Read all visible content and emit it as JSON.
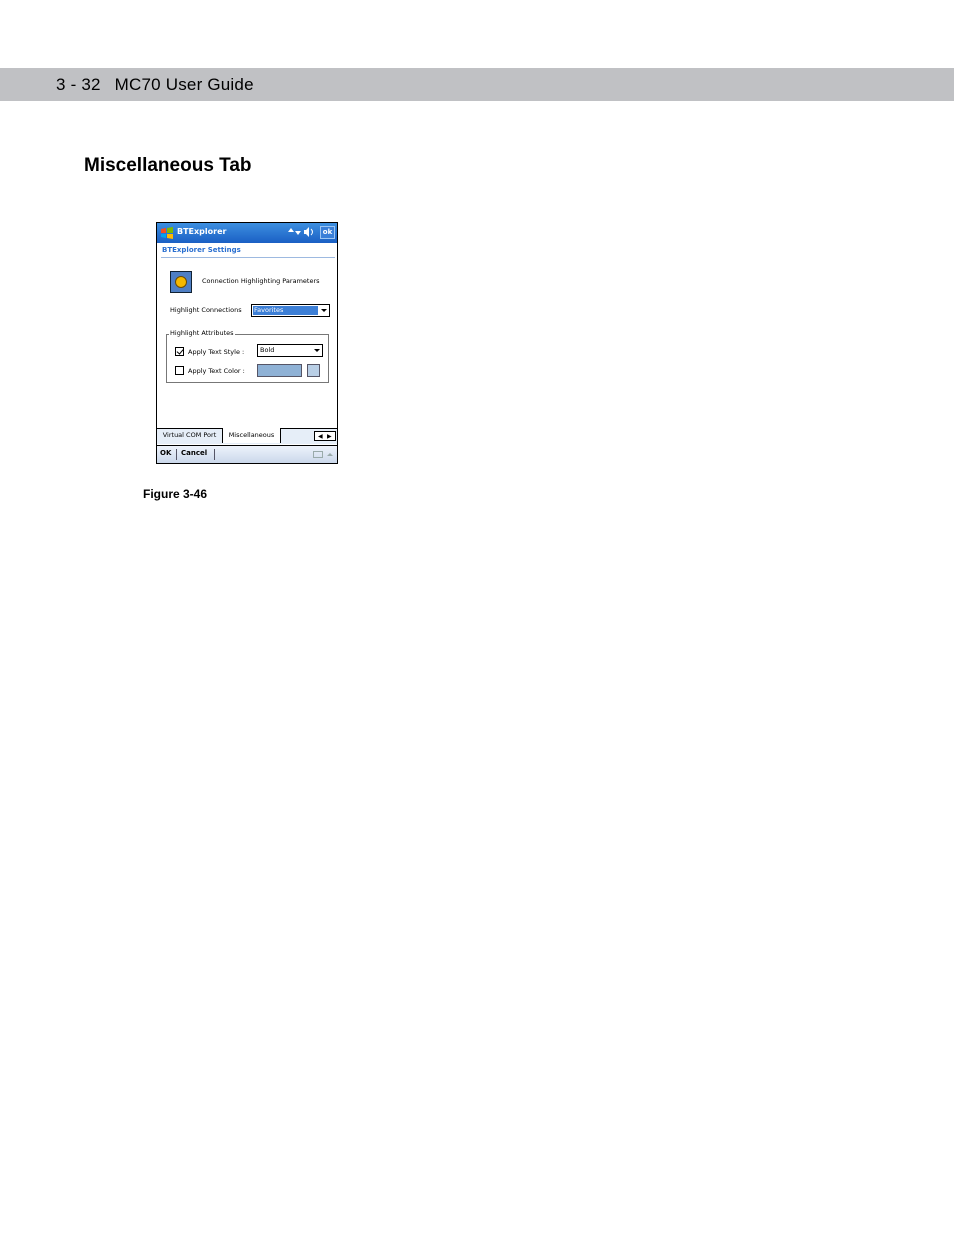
{
  "header": {
    "page_ref": "3 - 32",
    "guide_title": "MC70 User Guide"
  },
  "section": {
    "title": "Miscellaneous Tab"
  },
  "figure": {
    "caption": "Figure 3-46"
  },
  "screen": {
    "app_title": "BTExplorer",
    "status_icons": "▴▾ ◀%",
    "ok_label": "ok",
    "subtitle": "BTExplorer Settings",
    "connection_label": "Connection Highlighting Parameters",
    "highlight_connections_label": "Highlight Connections",
    "highlight_connections_value": "Favorites",
    "group_label": "Highlight Attributes",
    "apply_text_style_label": "Apply Text Style :",
    "apply_text_style_checked": true,
    "text_style_value": "Bold",
    "apply_text_color_label": "Apply Text Color :",
    "apply_text_color_checked": false,
    "text_color": "#8fb2d6",
    "tabs": [
      "Virtual COM Port",
      "Miscellaneous"
    ],
    "active_tab": "Miscellaneous",
    "scroll_left": "◀",
    "scroll_right": "▶",
    "menu": {
      "ok": "OK",
      "cancel": "Cancel"
    }
  }
}
